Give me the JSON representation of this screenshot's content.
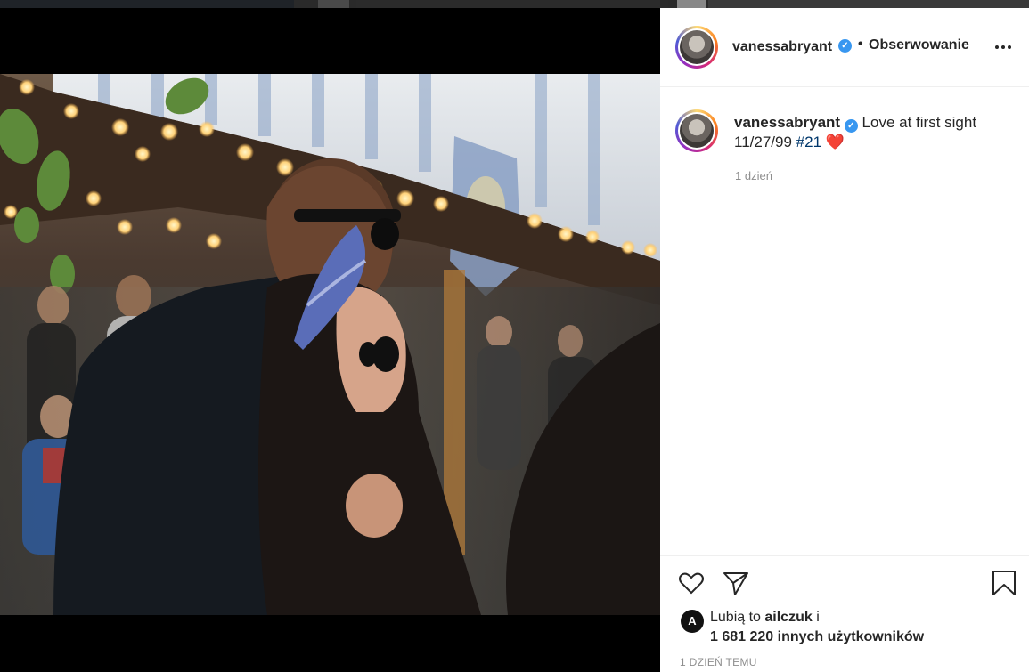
{
  "colors": {
    "background": "#000000",
    "sidebar": "#ffffff",
    "verified": "#3897f0",
    "text_primary": "#262626",
    "text_secondary": "#8e8e8e",
    "hashtag": "#00376b",
    "heart_emoji": "#e0245e"
  },
  "header": {
    "username": "vanessabryant",
    "separator": "•",
    "follow_label": "Obserwowanie",
    "more_icon": "more-dots-icon"
  },
  "caption": {
    "username": "vanessabryant",
    "text": "Love at first sight",
    "date_text": "11/27/99",
    "hashtag": "#21",
    "emoji": "❤️",
    "time_ago": "1 dzień"
  },
  "actions": {
    "like_icon": "heart-icon",
    "share_icon": "send-icon",
    "save_icon": "bookmark-icon"
  },
  "likes": {
    "prefix": "Lubią to",
    "liker": "ailczuk",
    "suffix": "i",
    "others": "1 681 220 innych użytkowników"
  },
  "post_date": "1 DZIEŃ TEMU",
  "photo": {
    "icon": "post-photo"
  }
}
